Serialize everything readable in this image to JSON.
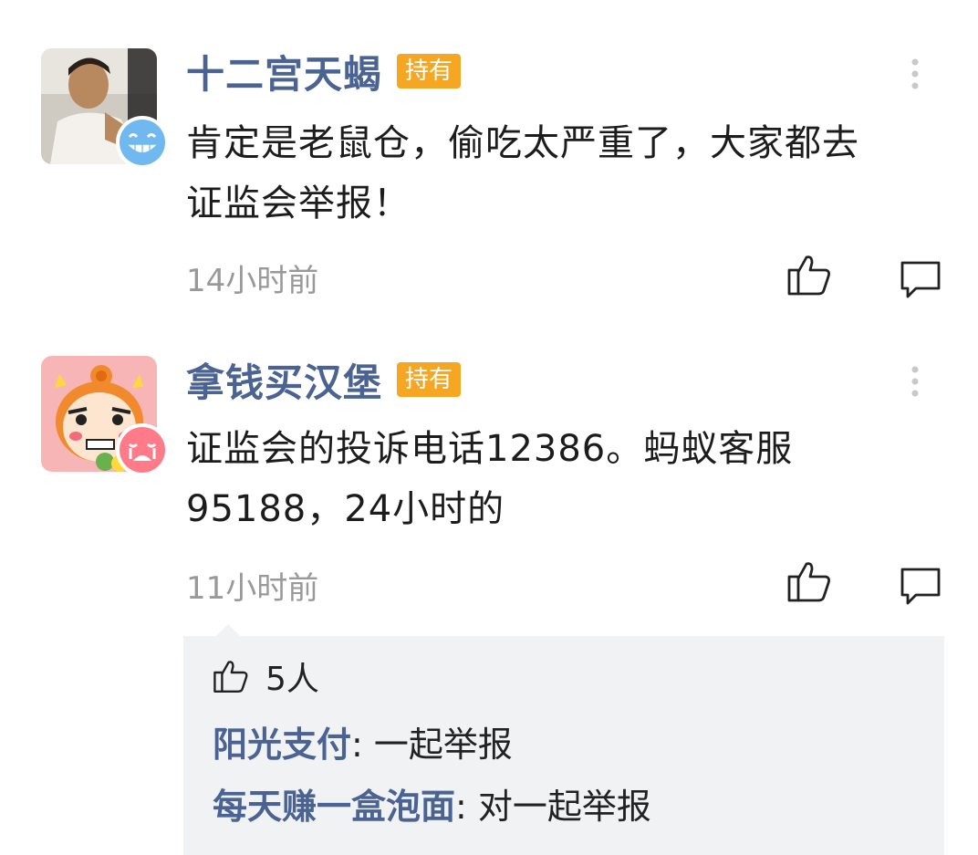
{
  "comments": [
    {
      "username": "十二宫天蝎",
      "badge": "持有",
      "content_line1": "肯定是老鼠仓，偷吃太严重了，大家都去",
      "content_line2": "证监会举报！",
      "time": "14小时前"
    },
    {
      "username": "拿钱买汉堡",
      "badge": "持有",
      "content_line1": "证监会的投诉电话12386。蚂蚁客服",
      "content_line2": "95188，24小时的",
      "time": "11小时前",
      "replies": {
        "like_count": "5人",
        "items": [
          {
            "user": "阳光支付",
            "sep": ": ",
            "text": "一起举报"
          },
          {
            "user": "每天赚一盒泡面",
            "sep": ": ",
            "text": "对一起举报"
          }
        ]
      }
    }
  ],
  "colors": {
    "username": "#4a6393",
    "badge_bg": "#f5a623",
    "time": "#999999",
    "reply_bg": "#f1f2f4"
  }
}
